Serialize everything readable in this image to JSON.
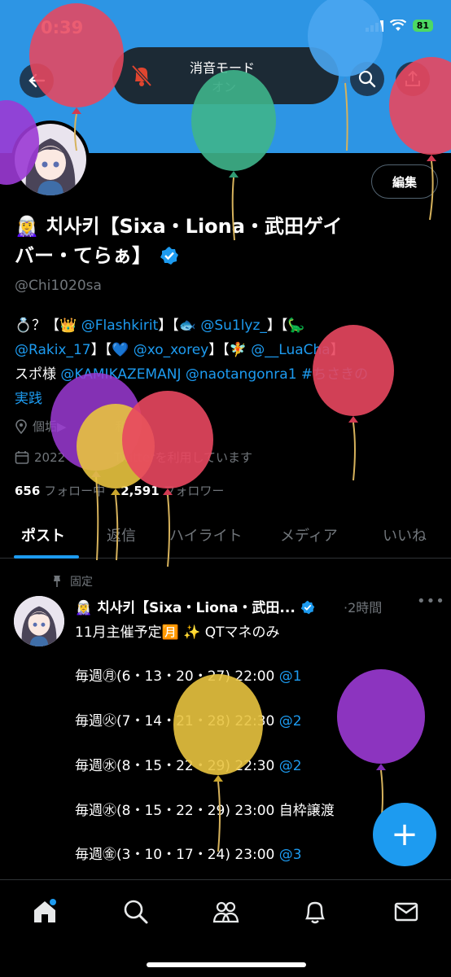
{
  "status": {
    "time": "0:39",
    "battery": "81"
  },
  "silent_mode": {
    "title": "消音モード",
    "state": "オン"
  },
  "profile": {
    "edit_label": "編集",
    "name_line1": "🧝‍♀️ 치사키【Sixa・Liona・武田ゲイ",
    "name_line2": "バー・てらぁ】",
    "handle": "@Chi1020sa",
    "bio": {
      "l1_a": "💍？【👑 ",
      "l1_b": "@Flashkirit",
      "l1_c": "】【🐟 ",
      "l1_d": "@Su1lyz_",
      "l1_e": "】【🦕",
      "l2_a": "@Rakix_17",
      "l2_b": "】【💙 ",
      "l2_c": "@xo_xorey",
      "l2_d": "】【🧚 ",
      "l2_e": "@__LuaCha",
      "l2_f": "】",
      "l3_a": "スポ様 ",
      "l3_b": "@KAMIKAZEMANJ",
      "l3_c": " ",
      "l3_d": "@naotangonra1",
      "l3_e": " ",
      "l3_f": "#ちさきの",
      "l4": "実践"
    },
    "location": "個垢▶︎　　　　和",
    "joined": "2022　　　　Twitterを利用しています",
    "following_count": "656",
    "following_label": "フォロー中",
    "followers_count": "2,591",
    "followers_label": "フォロワー"
  },
  "tabs": [
    "ポスト",
    "返信",
    "ハイライト",
    "メディア",
    "いいね"
  ],
  "post": {
    "pinned_label": "固定",
    "author": "🧝‍♀️ 치사키【Sixa・Liona・武田...",
    "time": "·2時間",
    "more": "•••",
    "lines": [
      {
        "text": "11月主催予定🈷️ ✨ QTマネのみ",
        "mention": ""
      },
      {
        "text": "毎週㊊(6・13・20・27) 22:00 ",
        "mention": "@1"
      },
      {
        "text": "毎週㊋(7・14・21・28) 22:30 ",
        "mention": "@2"
      },
      {
        "text": "毎週㊌(8・15・22・29) 22:30 ",
        "mention": "@2"
      },
      {
        "text": "毎週㊌(8・15・22・29) 23:00 自枠譲渡",
        "mention": ""
      },
      {
        "text": "毎週㊎(3・10・17・24)  23:00 ",
        "mention": "@3"
      }
    ]
  },
  "fab_label": "+",
  "colors": {
    "accent": "#1d9bf0",
    "banner": "#2d95e4",
    "muted": "#71767b"
  }
}
